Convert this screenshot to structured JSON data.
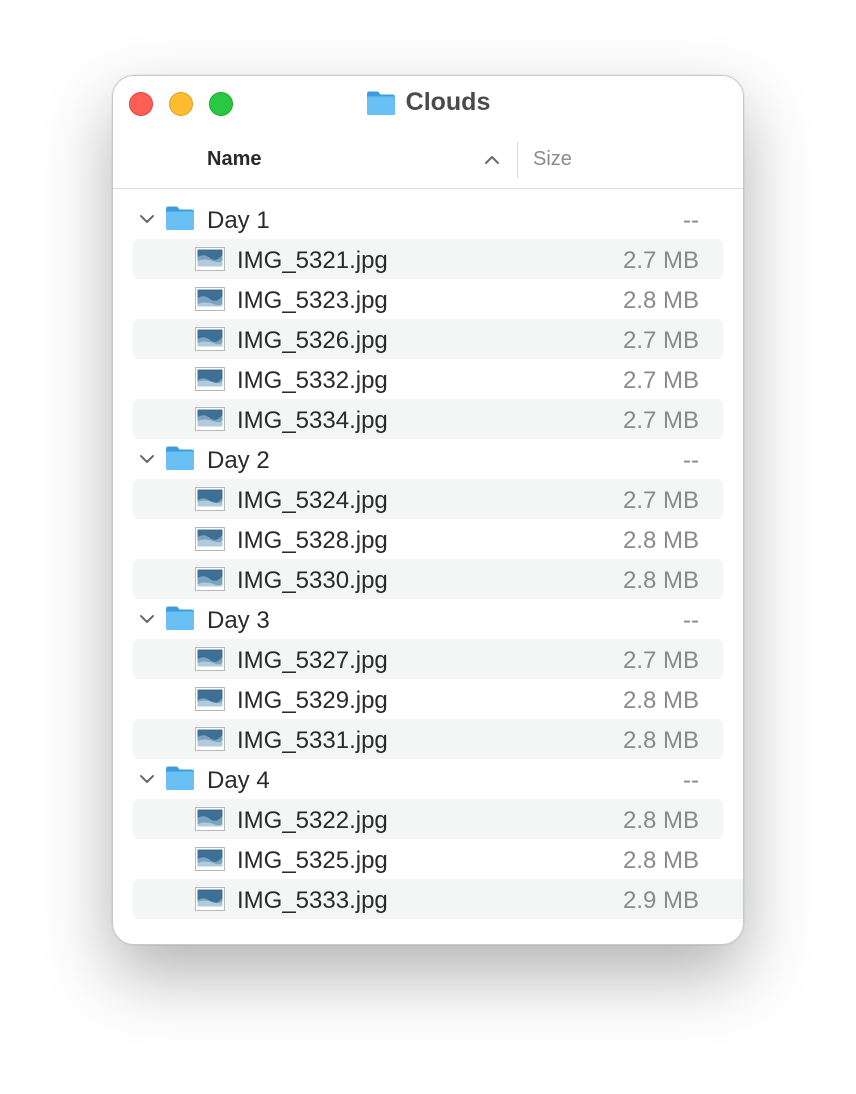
{
  "window": {
    "title": "Clouds",
    "title_icon": "folder-icon"
  },
  "columns": {
    "name": "Name",
    "size": "Size",
    "sort": "ascending"
  },
  "colors": {
    "folder": "#5ab3f0",
    "close": "#fe5f57",
    "minimize": "#febc2e",
    "zoom": "#28c840",
    "stripe": "#f4f5f5"
  },
  "groups": [
    {
      "name": "Day 1",
      "size": "--",
      "files": [
        {
          "name": "IMG_5321.jpg",
          "size": "2.7 MB"
        },
        {
          "name": "IMG_5323.jpg",
          "size": "2.8 MB"
        },
        {
          "name": "IMG_5326.jpg",
          "size": "2.7 MB"
        },
        {
          "name": "IMG_5332.jpg",
          "size": "2.7 MB"
        },
        {
          "name": "IMG_5334.jpg",
          "size": "2.7 MB"
        }
      ]
    },
    {
      "name": "Day 2",
      "size": "--",
      "files": [
        {
          "name": "IMG_5324.jpg",
          "size": "2.7 MB"
        },
        {
          "name": "IMG_5328.jpg",
          "size": "2.8 MB"
        },
        {
          "name": "IMG_5330.jpg",
          "size": "2.8 MB"
        }
      ]
    },
    {
      "name": "Day 3",
      "size": "--",
      "files": [
        {
          "name": "IMG_5327.jpg",
          "size": "2.7 MB"
        },
        {
          "name": "IMG_5329.jpg",
          "size": "2.8 MB"
        },
        {
          "name": "IMG_5331.jpg",
          "size": "2.8 MB"
        }
      ]
    },
    {
      "name": "Day 4",
      "size": "--",
      "files": [
        {
          "name": "IMG_5322.jpg",
          "size": "2.8 MB"
        },
        {
          "name": "IMG_5325.jpg",
          "size": "2.8 MB"
        },
        {
          "name": "IMG_5333.jpg",
          "size": "2.9 MB"
        }
      ]
    }
  ]
}
